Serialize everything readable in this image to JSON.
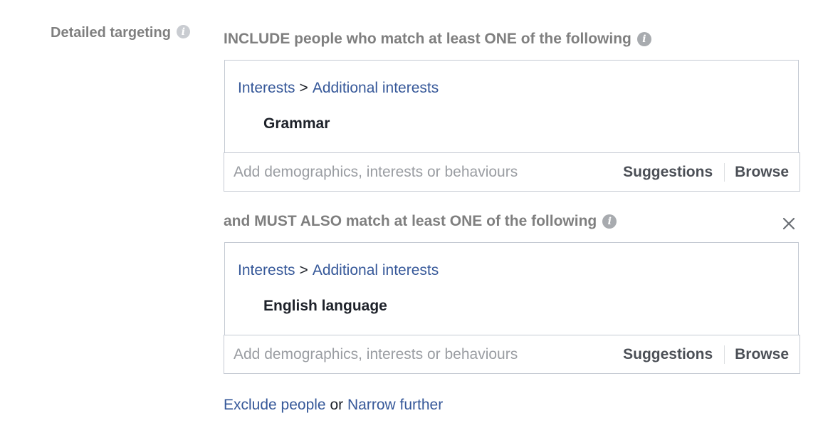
{
  "section": {
    "label": "Detailed targeting"
  },
  "include_group": {
    "heading": "INCLUDE people who match at least ONE of the following",
    "breadcrumb_category": "Interests",
    "breadcrumb_separator": ">",
    "breadcrumb_subcategory": "Additional interests",
    "selected_tag": "Grammar",
    "input_placeholder": "Add demographics, interests or behaviours",
    "suggestions_label": "Suggestions",
    "browse_label": "Browse"
  },
  "narrow_group": {
    "heading": "and MUST ALSO match at least ONE of the following",
    "breadcrumb_category": "Interests",
    "breadcrumb_separator": ">",
    "breadcrumb_subcategory": "Additional interests",
    "selected_tag": "English language",
    "input_placeholder": "Add demographics, interests or behaviours",
    "suggestions_label": "Suggestions",
    "browse_label": "Browse"
  },
  "footer": {
    "exclude_label": "Exclude people",
    "or_text": "or",
    "narrow_label": "Narrow further"
  },
  "icons": {
    "info": "info-icon",
    "close": "close-icon"
  },
  "colors": {
    "link": "#365899",
    "muted_heading": "#7f7f7f",
    "border": "#c5cad3",
    "placeholder": "#9a9da2"
  }
}
